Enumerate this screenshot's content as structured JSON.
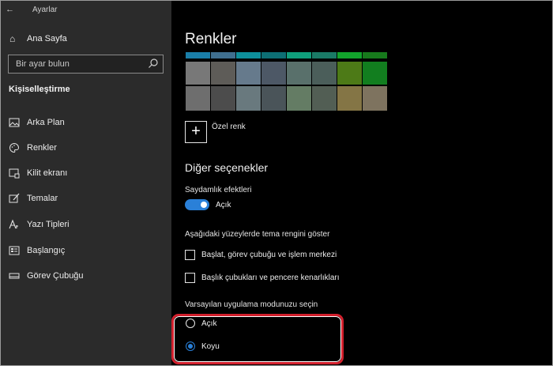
{
  "window": {
    "title": "Ayarlar"
  },
  "sidebar": {
    "home_label": "Ana Sayfa",
    "search_placeholder": "Bir ayar bulun",
    "section_heading": "Kişiselleştirme",
    "items": [
      {
        "label": "Arka Plan",
        "icon": "picture-icon"
      },
      {
        "label": "Renkler",
        "icon": "palette-icon",
        "active": true
      },
      {
        "label": "Kilit ekranı",
        "icon": "lock-screen-icon"
      },
      {
        "label": "Temalar",
        "icon": "theme-brush-icon"
      },
      {
        "label": "Yazı Tipleri",
        "icon": "font-icon"
      },
      {
        "label": "Başlangıç",
        "icon": "start-icon"
      },
      {
        "label": "Görev Çubuğu",
        "icon": "taskbar-icon"
      }
    ]
  },
  "main": {
    "title": "Renkler",
    "swatch_rows": [
      [
        "#1a7ea8",
        "#3f6f8f",
        "#0e8f9b",
        "#0d6f74",
        "#0f9e7b",
        "#1a7a66",
        "#12a32c",
        "#177a1c"
      ],
      [
        "#787878",
        "#5e5c58",
        "#667a8c",
        "#4d5866",
        "#59706b",
        "#4b5e5a",
        "#4d7a17",
        "#127e1f"
      ],
      [
        "#6e6e6e",
        "#4c4c4c",
        "#69797e",
        "#4a5459",
        "#647c64",
        "#525e54",
        "#847545",
        "#7e735f"
      ]
    ],
    "custom_color_label": "Özel renk",
    "other_options_heading": "Diğer seçenekler",
    "transparency": {
      "label": "Saydamlık efektleri",
      "state_label": "Açık",
      "on": true
    },
    "accent_surfaces": {
      "label": "Aşağıdaki yüzeylerde tema rengini göster",
      "options": [
        {
          "label": "Başlat, görev çubuğu ve işlem merkezi",
          "checked": false
        },
        {
          "label": "Başlık çubukları ve pencere kenarlıkları",
          "checked": false
        }
      ]
    },
    "app_mode": {
      "label": "Varsayılan uygulama modunuzu seçin",
      "options": [
        {
          "label": "Açık",
          "selected": false
        },
        {
          "label": "Koyu",
          "selected": true
        }
      ]
    }
  },
  "colors": {
    "accent": "#2a80d8",
    "highlight_border": "#d21f2c"
  }
}
